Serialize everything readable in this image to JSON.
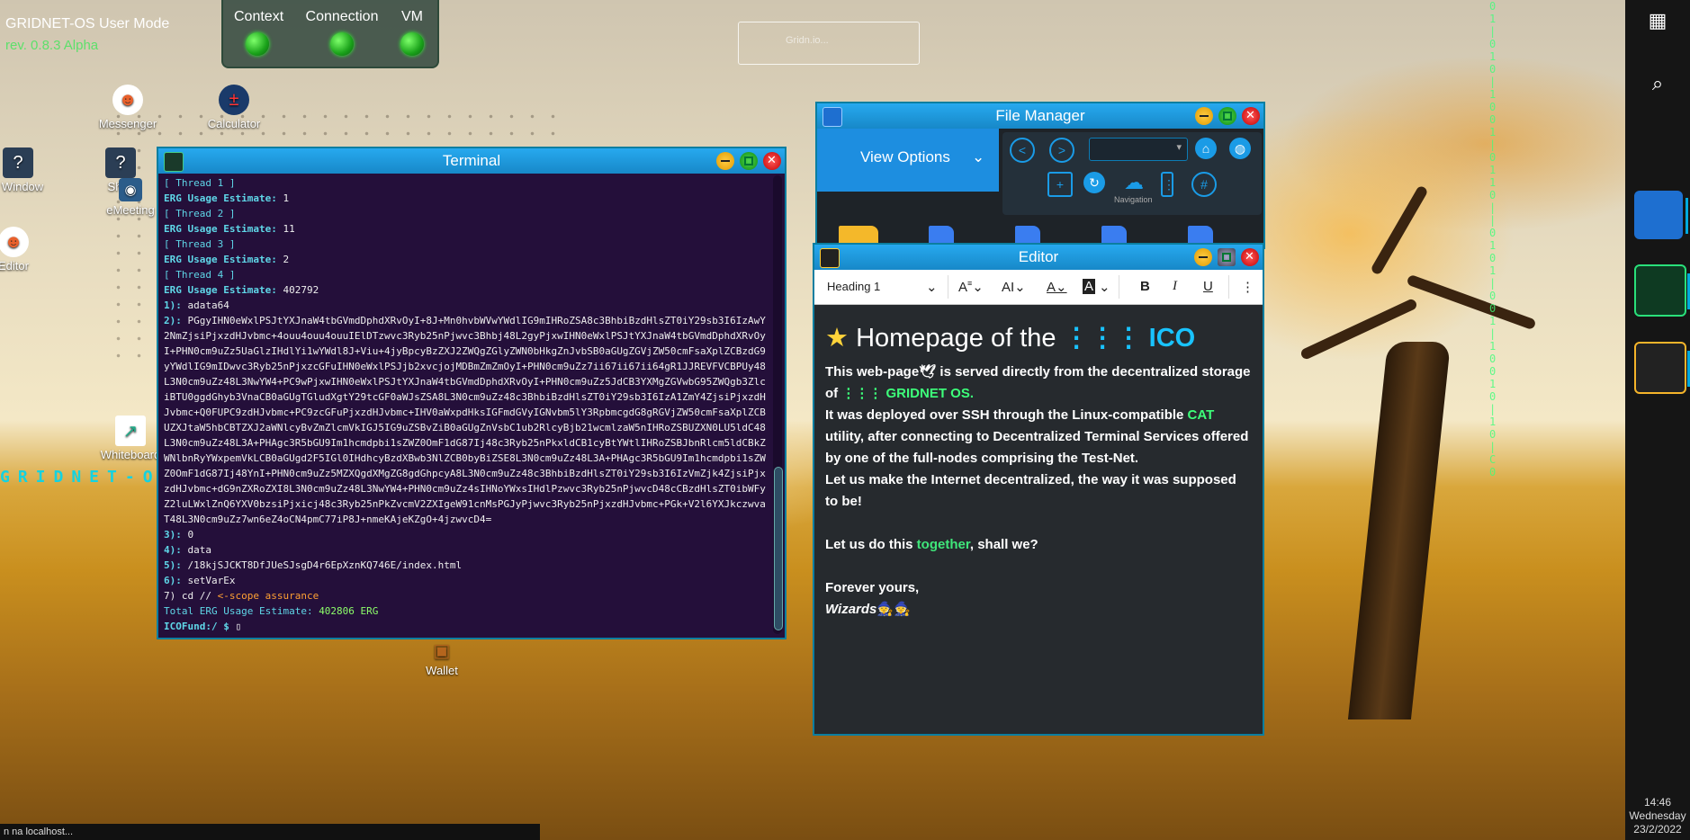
{
  "system": {
    "title": "GRIDNET-OS User Mode",
    "revision": "rev. 0.8.3 Alpha",
    "statusbar_text": "n na localhost..."
  },
  "status_panel": {
    "items": [
      {
        "label": "Context",
        "state": "ok"
      },
      {
        "label": "Connection",
        "state": "ok"
      },
      {
        "label": "VM",
        "state": "ok"
      }
    ]
  },
  "ghost_box": {
    "text": "Gridn.io..."
  },
  "desktop_icons": [
    {
      "label": "Messenger",
      "icon": "messenger-icon"
    },
    {
      "label": "Calculator",
      "icon": "calculator-icon"
    },
    {
      "label": "v Window",
      "icon": "window-icon"
    },
    {
      "label": "Shell",
      "icon": "shell-icon"
    },
    {
      "label": "eMeeting",
      "icon": "meeting-icon"
    },
    {
      "label": "Editor",
      "icon": "editor-icon"
    },
    {
      "label": "Whiteboard",
      "icon": "whiteboard-icon"
    },
    {
      "label": "Wallet",
      "icon": "wallet-icon"
    }
  ],
  "gridnet_vertical": "GRIDNET-O",
  "taskbar": {
    "clock_time": "14:46",
    "clock_day": "Wednesday",
    "clock_date": "23/2/2022"
  },
  "terminal": {
    "title": "Terminal",
    "lines": [
      {
        "type": "cyan",
        "text": "[ Thread 1 ]"
      },
      {
        "type": "kv",
        "key": "ERG Usage Estimate:",
        "value": " 1"
      },
      {
        "type": "cyan",
        "text": "[ Thread 2 ]"
      },
      {
        "type": "kv",
        "key": "ERG Usage Estimate:",
        "value": " 11"
      },
      {
        "type": "cyan",
        "text": "[ Thread 3 ]"
      },
      {
        "type": "kv",
        "key": "ERG Usage Estimate:",
        "value": " 2"
      },
      {
        "type": "cyan",
        "text": "[ Thread 4 ]"
      },
      {
        "type": "kv",
        "key": "ERG Usage Estimate:",
        "value": " 402792"
      },
      {
        "type": "kv",
        "key": "1):",
        "value": " adata64"
      },
      {
        "type": "wrapkv",
        "key": "2):",
        "value": " PGgyIHN0eWxlPSJtYXJnaW4tbGVmdDphdXRvOyI+8J+Mn0hvbWVwYWdlIG9mIHRoZSA8c3BhbiBzdHlsZT0iY29sb3I6IzAwY2NmZjsiPjxzdHJvbmc+4ouu4ouu4ouuIElDTzwvc3Ryb25nPjwvc3Bhbj48L2gyPjxwIHN0eWxlPSJtYXJnaW4tbGVmdDphdXRvOyI+PHN0cm9uZz5UaGlzIHdlYi1wYWdl8J+Viu+4jyBpcyBzZXJ2ZWQgZGlyZWN0bHkgZnJvbSB0aGUgZGVjZW50cmFsaXplZCBzdG9yYWdlIG9mIDwvc3Ryb25nPjxzcGFuIHN0eWxlPSJjb2xvcjojMDBmZmZmOyI+PHN0cm9uZz7ii67ii67ii64gR1JJREVFVCBPUy48L3N0cm9uZz48L3NwYW4+PC9wPjxwIHN0eWxlPSJtYXJnaW4tbGVmdDphdXRvOyI+PHN0cm9uZz5JdCB3YXMgZGVwbG95ZWQgb3ZlciBTU0ggdGhyb3VnaCB0aGUgTGludXgtY29tcGF0aWJsZSA8L3N0cm9uZz48c3BhbiBzdHlsZT0iY29sb3I6IzA1ZmY4ZjsiPjxzdHJvbmc+Q0FUPC9zdHJvbmc+PC9zcGFuPjxzdHJvbmc+IHV0aWxpdHksIGFmdGVyIGNvbm5lY3RpbmcgdG8gRGVjZW50cmFsaXplZCBUZXJtaW5hbCBTZXJ2aWNlcyBvZmZlcmVkIGJ5IG9uZSBvZiB0aGUgZnVsbC1ub2RlcyBjb21wcmlzaW5nIHRoZSBUZXN0LU5ldC48L3N0cm9uZz48L3A+PHAgc3R5bGU9Im1hcmdpbi1sZWZ0OmF1dG87Ij48c3Ryb25nPkxldCB1cyBtYWtlIHRoZSBJbnRlcm5ldCBkZWNlbnRyYWxpemVkLCB0aGUgd2F5IGl0IHdhcyBzdXBwb3NlZCB0byBiZSE8L3N0cm9uZz48L3A+PHAgc3R5bGU9Im1hcmdpbi1sZWZ0OmF1dG87Ij48YnI+PHN0cm9uZz5MZXQgdXMgZG8gdGhpcyA8L3N0cm9uZz48c3BhbiBzdHlsZT0iY29sb3I6IzVmZjk4ZjsiPjxzdHJvbmc+dG9nZXRoZXI8L3N0cm9uZz48L3NwYW4+PHN0cm9uZz4sIHNoYWxsIHdlPzwvc3Ryb25nPjwvcD48cCBzdHlsZT0ibWFyZ2luLWxlZnQ6YXV0bzsiPjxicj48c3Ryb25nPkZvcmV2ZXIgeW91cnMsPGJyPjwvc3Ryb25nPjxzdHJvbmc+PGk+V2l6YXJkczwvaT48L3N0cm9uZz7wn6eZ4oCN4pmC77iP8J+nmeKAjeKZgO+4jzwvcD4="
      },
      {
        "type": "kv",
        "key": "3):",
        "value": " 0"
      },
      {
        "type": "kv",
        "key": "4):",
        "value": " data"
      },
      {
        "type": "kv",
        "key": "5):",
        "value": " /18kjSJCKT8DfJUeSJsgD4r6EpXznKQ746E/index.html"
      },
      {
        "type": "kv",
        "key": "6):",
        "value": " setVarEx"
      },
      {
        "type": "cmd",
        "text": "7) cd // ",
        "comment": "<-scope assurance"
      },
      {
        "type": "total",
        "text": "Total ERG Usage Estimate: ",
        "value": "402806 ERG"
      }
    ],
    "prompt": "ICOFund:/ $ "
  },
  "file_manager": {
    "title": "File Manager",
    "view_options_label": "View Options",
    "navigation_label": "Navigation",
    "path_value": ""
  },
  "editor": {
    "title": "Editor",
    "block_format": "Heading 1",
    "heading_prefix": "Homepage of the ",
    "heading_ico": "⋮⋮⋮ ICO",
    "p1_a": "This web-page",
    "p1_b": " is served directly from the decentralized storage of ",
    "p1_gridnet": "⋮⋮⋮ GRIDNET OS.",
    "p2_a": "It was deployed over SSH through the Linux-compatible ",
    "p2_cat": "CAT",
    "p2_b": " utility, after connecting to Decentralized Terminal Services offered by one of the full-nodes comprising the Test-Net.",
    "p3": "Let us make the Internet decentralized, the way it was supposed to be!",
    "p4_a": "Let us do this ",
    "p4_together": "together",
    "p4_b": ", shall we?",
    "p5": "Forever yours,",
    "p6": "Wizards"
  },
  "colors": {
    "accent_blue": "#1e9be6",
    "terminal_bg": "#240f3a",
    "cyan_text": "#5fd7e8",
    "green_text": "#3dff7a",
    "ico_blue": "#19c3ff"
  }
}
